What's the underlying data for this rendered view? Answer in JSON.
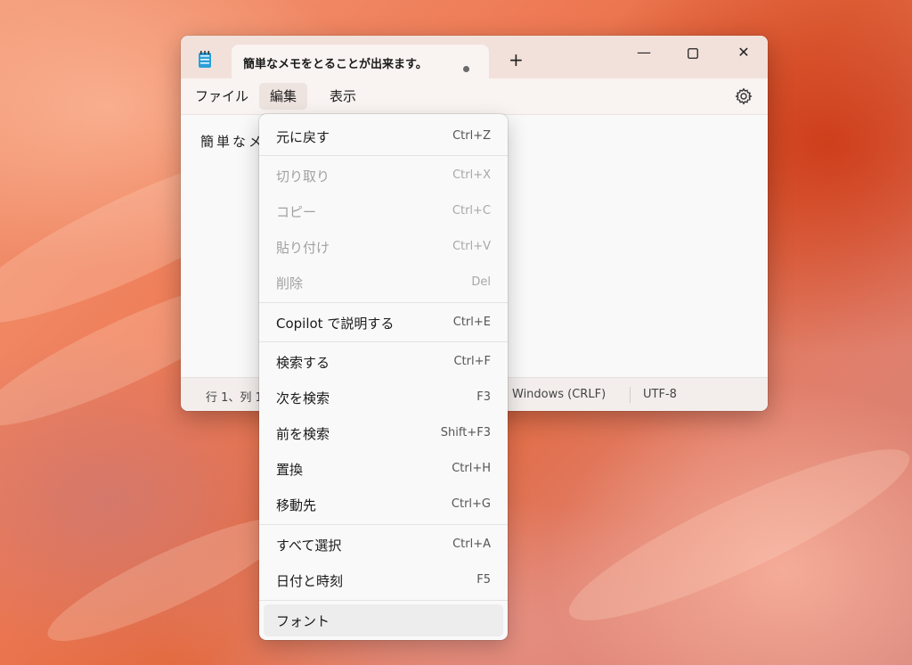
{
  "window": {
    "tab_title": "簡単なメモをとることが出来ます。",
    "new_tab": "+",
    "minimize": "—",
    "close": "✕"
  },
  "menubar": {
    "file": "ファイル",
    "edit": "編集",
    "view": "表示"
  },
  "editor": {
    "text": "簡単なメ"
  },
  "status": {
    "position": "行 1、列 1",
    "line_ending": "Windows (CRLF)",
    "encoding": "UTF-8"
  },
  "edit_menu": {
    "items": [
      {
        "label": "元に戻す",
        "shortcut": "Ctrl+Z"
      },
      {
        "label": "切り取り",
        "shortcut": "Ctrl+X"
      },
      {
        "label": "コピー",
        "shortcut": "Ctrl+C"
      },
      {
        "label": "貼り付け",
        "shortcut": "Ctrl+V"
      },
      {
        "label": "削除",
        "shortcut": "Del"
      },
      {
        "label": "Copilot で説明する",
        "shortcut": "Ctrl+E"
      },
      {
        "label": "検索する",
        "shortcut": "Ctrl+F"
      },
      {
        "label": "次を検索",
        "shortcut": "F3"
      },
      {
        "label": "前を検索",
        "shortcut": "Shift+F3"
      },
      {
        "label": "置換",
        "shortcut": "Ctrl+H"
      },
      {
        "label": "移動先",
        "shortcut": "Ctrl+G"
      },
      {
        "label": "すべて選択",
        "shortcut": "Ctrl+A"
      },
      {
        "label": "日付と時刻",
        "shortcut": "F5"
      },
      {
        "label": "フォント",
        "shortcut": ""
      }
    ]
  }
}
